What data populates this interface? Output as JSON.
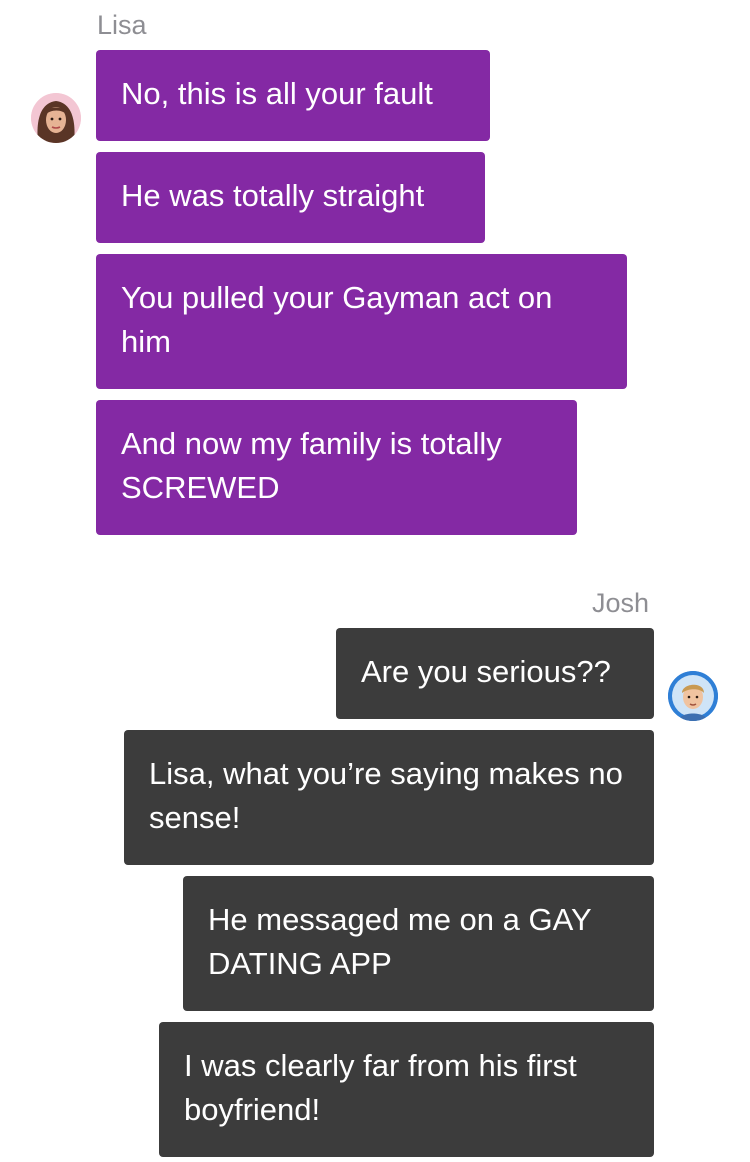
{
  "lisa": {
    "name": "Lisa",
    "avatar_icon": "woman-portrait-icon",
    "color": "#8429a4",
    "messages": [
      "No, this is all your fault",
      "He was totally straight",
      "You pulled your Gayman act on him",
      "And now my family is totally SCREWED"
    ]
  },
  "josh": {
    "name": "Josh",
    "avatar_icon": "man-portrait-icon",
    "color": "#3c3c3c",
    "messages": [
      "Are you serious??",
      "Lisa, what you’re saying makes no sense!",
      "He messaged me on a GAY DATING APP",
      "I was clearly far from his first boyfriend!"
    ]
  }
}
